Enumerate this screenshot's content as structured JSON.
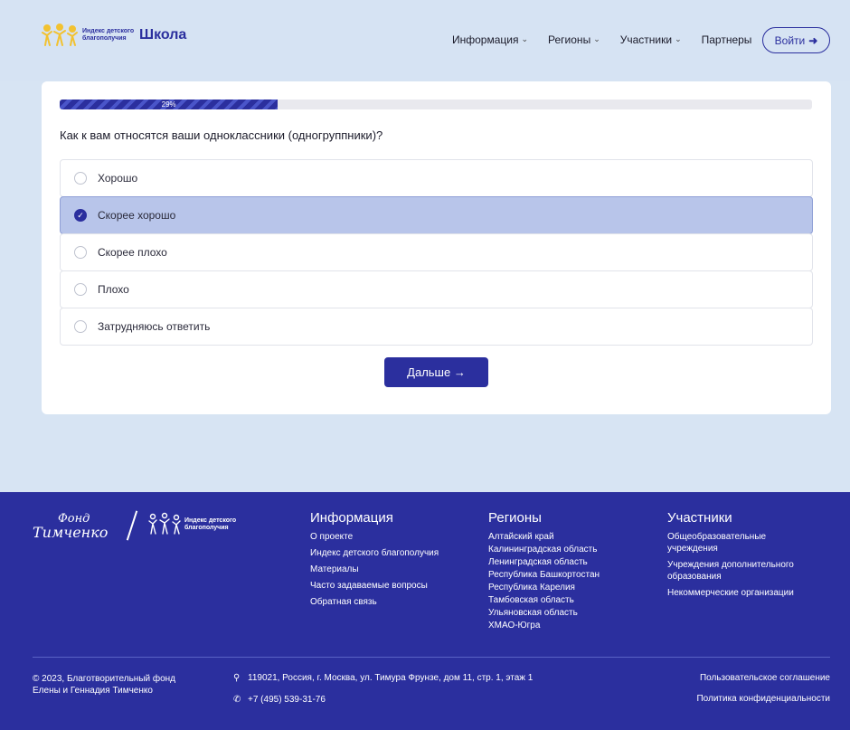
{
  "header": {
    "logo_subtitle": "Индекс детского благополучия",
    "logo_title": "Школа",
    "nav": [
      {
        "label": "Информация",
        "has_dropdown": true
      },
      {
        "label": "Регионы",
        "has_dropdown": true
      },
      {
        "label": "Участники",
        "has_dropdown": true
      },
      {
        "label": "Партнеры",
        "has_dropdown": false
      }
    ],
    "login_label": "Войти",
    "login_icon": "arrow-right-icon"
  },
  "survey": {
    "progress_percent": 29,
    "progress_label": "29%",
    "question": "Как к вам относятся ваши одноклассники (одногруппники)?",
    "options": [
      {
        "label": "Хорошо",
        "selected": false
      },
      {
        "label": "Скорее хорошо",
        "selected": true
      },
      {
        "label": "Скорее плохо",
        "selected": false
      },
      {
        "label": "Плохо",
        "selected": false
      },
      {
        "label": "Затрудняюсь ответить",
        "selected": false
      }
    ],
    "next_label": "Дальше →"
  },
  "footer": {
    "logo_fond_top": "Фонд",
    "logo_fond_bottom": "Тимченко",
    "logo_index": "Индекс детского благополучия",
    "columns": {
      "info": {
        "title": "Информация",
        "links": [
          "О проекте",
          "Индекс детского благополучия",
          "Материалы",
          "Часто задаваемые вопросы",
          "Обратная связь"
        ]
      },
      "regions": {
        "title": "Регионы",
        "links": [
          "Алтайский край",
          "Калининградская область",
          "Ленинградская область",
          "Республика Башкортостан",
          "Республика Карелия",
          "Тамбовская область",
          "Ульяновская область",
          "ХМАО-Югра"
        ]
      },
      "participants": {
        "title": "Участники",
        "links": [
          "Общеобразовательные учреждения",
          "Учреждения дополнительного образования",
          "Некоммерческие организации"
        ]
      }
    },
    "copyright": "© 2023, Благотворительный фонд Елены и Геннадия Тимченко",
    "address": "119021, Россия, г. Москва, ул. Тимура Фрунзе, дом 11, стр. 1, этаж 1",
    "phone": "+7 (495) 539-31-76",
    "legal_links": [
      "Пользовательское соглашение",
      "Политика конфиденциальности"
    ]
  },
  "colors": {
    "accent": "#2b2f9e",
    "page_bg": "#d7e4f3",
    "selected_option_bg": "#b8c5ea",
    "logo_yellow": "#f2c230"
  }
}
